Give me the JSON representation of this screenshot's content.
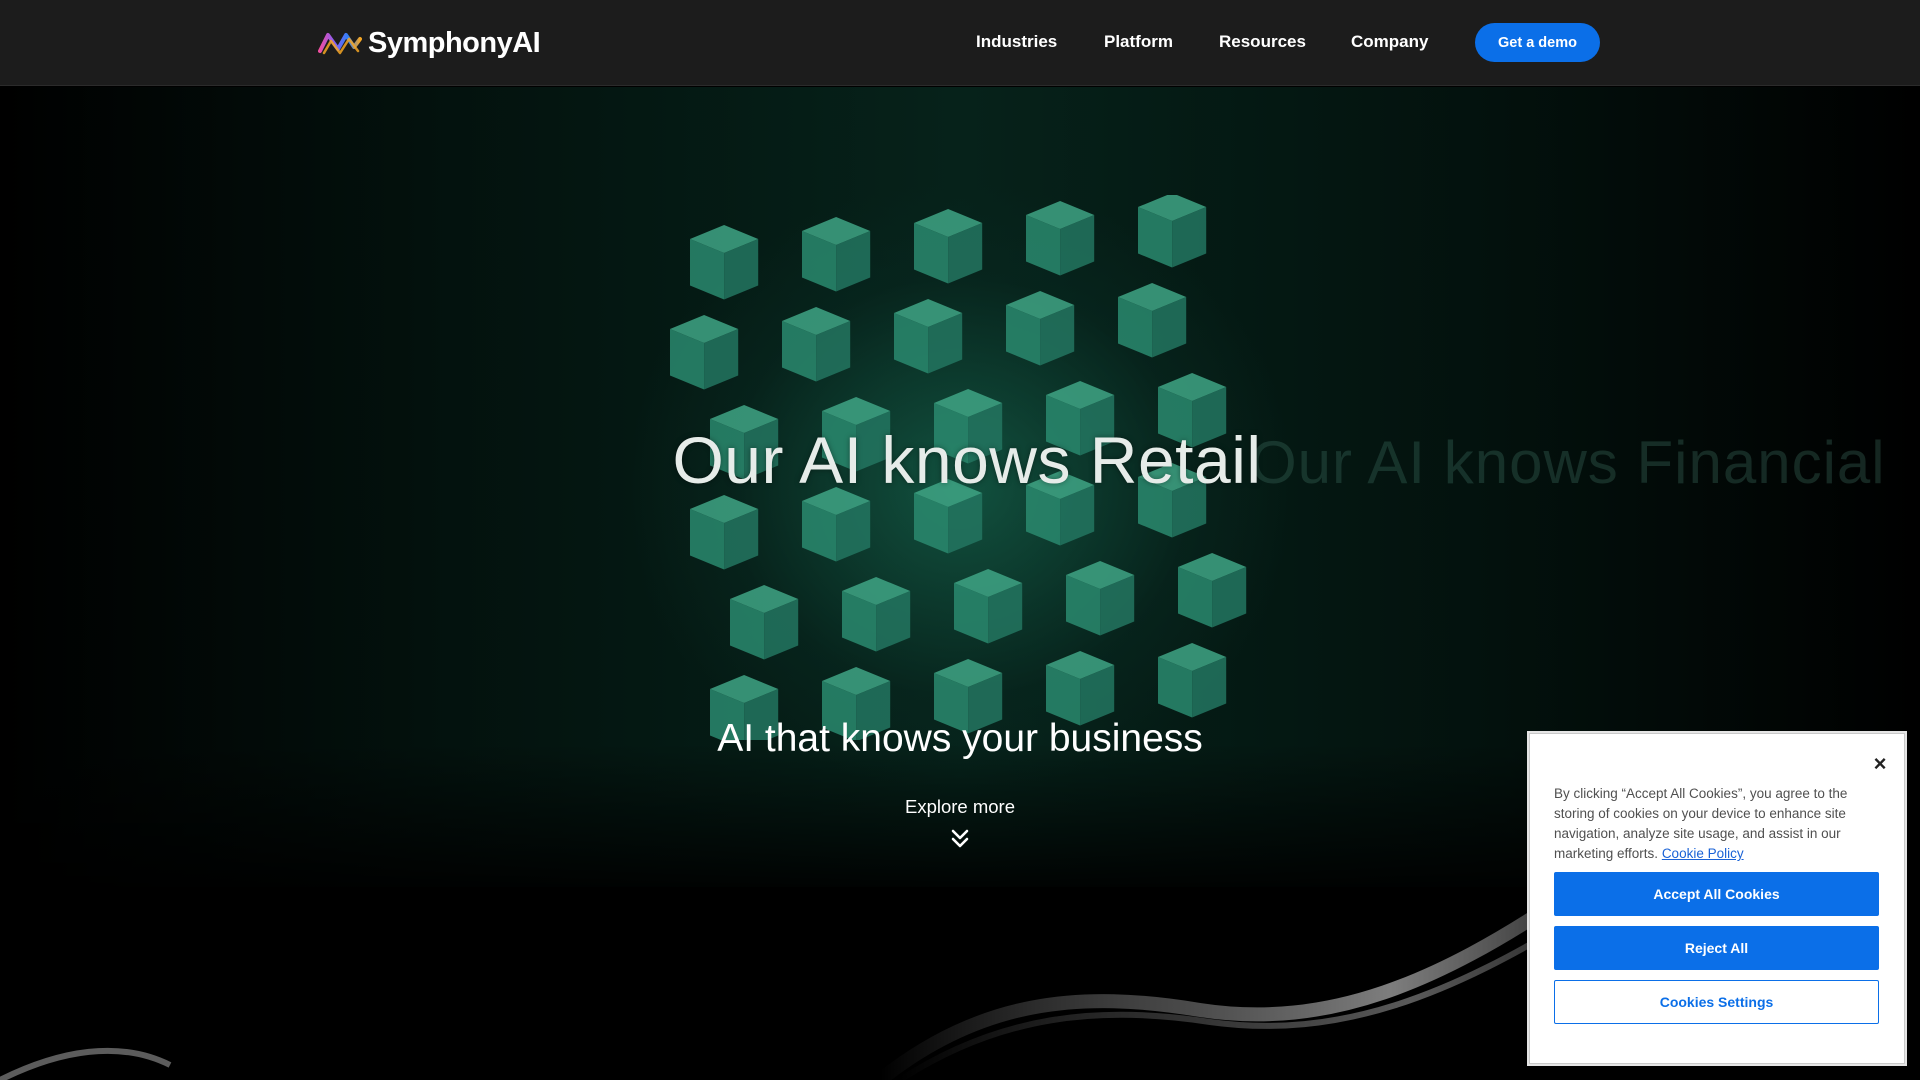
{
  "header": {
    "logo_text": "SymphonyAI",
    "nav": [
      "Industries",
      "Platform",
      "Resources",
      "Company"
    ],
    "cta_label": "Get a demo"
  },
  "hero": {
    "headline": "Our AI knows Retail",
    "ghost_headline": "Our AI knows Financial",
    "subheadline": "AI that knows your business",
    "explore_label": "Explore more",
    "explore_icon": "double-chevron-down-icon"
  },
  "cookie_banner": {
    "close_label": "×",
    "text": "By clicking “Accept All Cookies”, you agree to the storing of cookies on your device to enhance site navigation, analyze site usage, and assist in our marketing efforts.",
    "policy_link": "Cookie Policy",
    "accept_label": "Accept All Cookies",
    "reject_label": "Reject All",
    "settings_label": "Cookies Settings"
  },
  "colors": {
    "accent": "#0b6fe8",
    "header_bg": "#1c1c1c",
    "cube_green": "#2a8a6e"
  }
}
